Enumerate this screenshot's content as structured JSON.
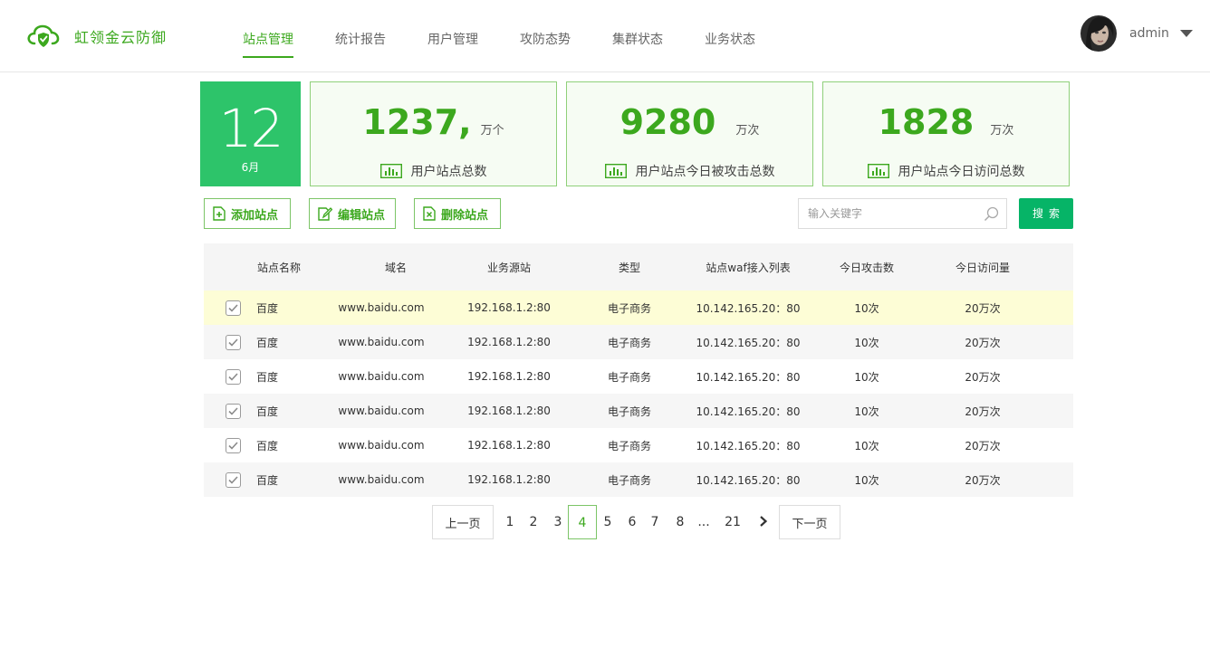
{
  "app": {
    "name": "虹领金云防御"
  },
  "nav": {
    "items": [
      {
        "label": "站点管理",
        "active": true
      },
      {
        "label": "统计报告",
        "active": false
      },
      {
        "label": "用户管理",
        "active": false
      },
      {
        "label": "攻防态势",
        "active": false
      },
      {
        "label": "集群状态",
        "active": false
      },
      {
        "label": "业务状态",
        "active": false
      }
    ]
  },
  "user": {
    "name": "admin",
    "avatar_icon": "user-avatar"
  },
  "date": {
    "day": "12",
    "month": "6月"
  },
  "stats": [
    {
      "value": "1237,",
      "unit": "万个",
      "label": "用户站点总数",
      "icon": "bar-chart-icon"
    },
    {
      "value": "9280",
      "unit": "万次",
      "label": "用户站点今日被攻击总数",
      "icon": "bar-chart-icon"
    },
    {
      "value": "1828",
      "unit": "万次",
      "label": "用户站点今日访问总数",
      "icon": "bar-chart-icon"
    }
  ],
  "toolbar": {
    "add_label": "添加站点",
    "edit_label": "编辑站点",
    "delete_label": "删除站点",
    "search_placeholder": "输入关键字",
    "search_label": "搜索"
  },
  "table": {
    "columns": [
      "站点名称",
      "域名",
      "业务源站",
      "类型",
      "站点waf接入列表",
      "今日攻击数",
      "今日访问量"
    ],
    "rows": [
      {
        "checked": true,
        "name": "百度",
        "domain": "www.baidu.com",
        "origin": "192.168.1.2:80",
        "type": "电子商务",
        "waf": "10.142.165.20：80",
        "attacks": "10次",
        "visits": "20万次"
      },
      {
        "checked": true,
        "name": "百度",
        "domain": "www.baidu.com",
        "origin": "192.168.1.2:80",
        "type": "电子商务",
        "waf": "10.142.165.20：80",
        "attacks": "10次",
        "visits": "20万次"
      },
      {
        "checked": true,
        "name": "百度",
        "domain": "www.baidu.com",
        "origin": "192.168.1.2:80",
        "type": "电子商务",
        "waf": "10.142.165.20：80",
        "attacks": "10次",
        "visits": "20万次"
      },
      {
        "checked": true,
        "name": "百度",
        "domain": "www.baidu.com",
        "origin": "192.168.1.2:80",
        "type": "电子商务",
        "waf": "10.142.165.20：80",
        "attacks": "10次",
        "visits": "20万次"
      },
      {
        "checked": true,
        "name": "百度",
        "domain": "www.baidu.com",
        "origin": "192.168.1.2:80",
        "type": "电子商务",
        "waf": "10.142.165.20：80",
        "attacks": "10次",
        "visits": "20万次"
      },
      {
        "checked": true,
        "name": "百度",
        "domain": "www.baidu.com",
        "origin": "192.168.1.2:80",
        "type": "电子商务",
        "waf": "10.142.165.20：80",
        "attacks": "10次",
        "visits": "20万次"
      }
    ],
    "highlighted_row": 0
  },
  "pagination": {
    "prev_label": "上一页",
    "next_label": "下一页",
    "pages": [
      "1",
      "2",
      "3",
      "4",
      "5",
      "6",
      "7",
      "8",
      "...",
      "21"
    ],
    "current": "4",
    "next_arrow_icon": "chevron-right-icon"
  },
  "colors": {
    "accent": "#3ca81e",
    "date_bg": "#2dc46a",
    "search_button": "#06b467",
    "highlight_row": "#fdfdd6"
  }
}
